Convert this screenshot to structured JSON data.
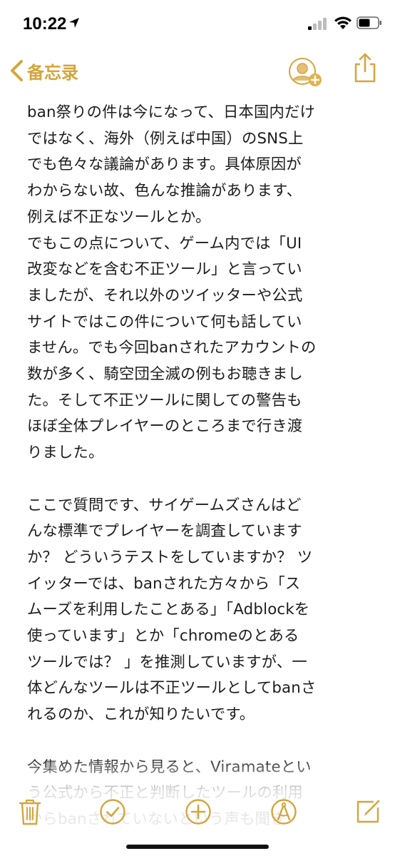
{
  "status_bar": {
    "time": "10:22"
  },
  "nav": {
    "back_label": "备忘录"
  },
  "colors": {
    "accent": "#d5a53b",
    "text": "#1c1c1c"
  },
  "icons": {
    "back": "chevron-left-icon",
    "add_person": "add-person-icon",
    "share": "share-icon",
    "trash": "trash-icon",
    "checklist": "checklist-icon",
    "add": "add-icon",
    "compass": "compass-icon",
    "compose": "compose-icon"
  },
  "note": {
    "lines": [
      "ban祭りの件は今になって、日本国内だけ",
      "ではなく、海外（例えば中国）のSNS上",
      "でも色々な議論があります。具体原因が",
      "わからない故、色んな推論があります、",
      "例えば不正なツールとか。",
      "でもこの点について、ゲーム内では「UI",
      "改変などを含む不正ツール」と言ってい",
      "ましたが、それ以外のツイッターや公式",
      "サイトではこの件について何も話してい",
      "ません。でも今回banされたアカウントの",
      "数が多く、騎空団全滅の例もお聴きまし",
      "た。そして不正ツールに関しての警告も",
      "ほぼ全体プレイヤーのところまで行き渡",
      "りました。",
      "",
      "ここで質問です、サイゲームズさんはど",
      "んな標準でプレイヤーを調査しています",
      "か？ どういうテストをしていますか？ ツ",
      "イッターでは、banされた方々から「ス",
      "ムーズを利用したことある」「Adblockを",
      "使っています」とか「chromeのとある",
      "ツールでは？ 」を推測していますが、一",
      "体どんなツールは不正ツールとしてbanさ",
      "れるのか、これが知りたいです。",
      "",
      "今集めた情報から見ると、Viramateとい",
      "う公式から不正と判断したツールの利用",
      "からbanされていないという声も聞き"
    ]
  }
}
